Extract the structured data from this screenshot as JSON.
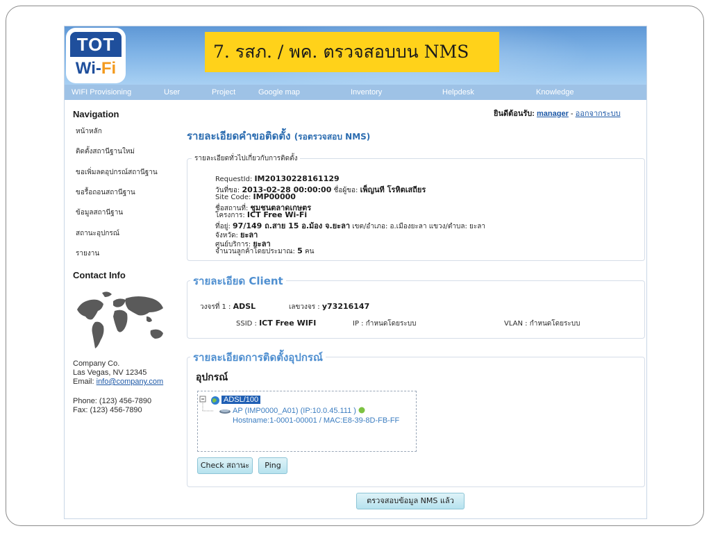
{
  "slide_title": "7. รสภ. / พค. ตรวจสอบบน NMS",
  "logo": {
    "top": "TOT",
    "wi": "Wi-",
    "fi": "Fi"
  },
  "nav": [
    "WIFI Provisioning",
    "User",
    "Project",
    "Google map",
    "Inventory",
    "Helpdesk",
    "Knowledge"
  ],
  "welcome": {
    "prefix": "ยินดีต้อนรับ:",
    "user": "manager",
    "sep": " - ",
    "logout": "ออกจากระบบ"
  },
  "sidebar": {
    "nav_title": "Navigation",
    "items": [
      "หน้าหลัก",
      "ติดตั้งสถานีฐานใหม่",
      "ขอเพิ่มลดอุปกรณ์สถานีฐาน",
      "ขอรื้อถอนสถานีฐาน",
      "ข้อมูลสถานีฐาน",
      "สถานะอุปกรณ์",
      "รายงาน"
    ],
    "contact_title": "Contact Info",
    "company_name": "Company Co.",
    "company_city": "Las Vegas, NV 12345",
    "email_label": "Email: ",
    "email": "info@company.com",
    "phone": "Phone: (123) 456-7890",
    "fax": "Fax: (123) 456-7890"
  },
  "heading": {
    "main": "รายละเอียดคำขอติดตั้ง",
    "sub": "(รอตรวจสอบ  NMS)"
  },
  "general": {
    "legend": "รายละเอียดทั่วไปเกี่ยวกับการติดตั้ง",
    "request_label": "RequestId: ",
    "request_value": "IM20130228161129",
    "date_label": "วันที่ขอ: ",
    "date_value": "2013-02-28 00:00:00",
    "requester_label": "  ชื่อผู้ขอ: ",
    "requester_value": "เพ็ญนที  โรหิตเสถียร",
    "site_code_label": "Site Code: ",
    "site_code_value": "IMP00000",
    "site_name_label": "ชื่อสถานที่: ",
    "site_name_value": "ชุมชนตลาดเกษตร",
    "project_label": "โครงการ: ",
    "project_value": "ICT Free Wi-Fi",
    "address_label": "ที่อยู่: ",
    "address_value": "97/149 ถ.สาย 15 อ.ม้อง จ.ยะลา",
    "address_rest": " เขต/อำเภอ: อ.เมืองยะลา แขวง/ตำบล: ยะลา",
    "province_label": "จังหวัด: ",
    "province_value": "ยะลา",
    "service_center_label": "ศูนย์บริการ: ",
    "service_center_value": "ยะลา",
    "customers_label": "จำนวนลูกค้าโดยประมาณ:  ",
    "customers_value": "5",
    "customers_unit": "  คน"
  },
  "client": {
    "legend": "รายละเอียด Client",
    "circuit_label": "วงจรที่ 1  : ",
    "circuit_value": "ADSL",
    "number_label": "เลขวงจร : ",
    "number_value": "y73216147",
    "ssid_label": "SSID : ",
    "ssid_value": "ICT Free WIFI",
    "ip_label": "IP :  ",
    "ip_value": "กำหนดโดยระบบ",
    "vlan_label": "VLAN :  ",
    "vlan_value": "กำหนดโดยระบบ"
  },
  "device": {
    "legend": "รายละเอียดการติดตั้งอุปกรณ์",
    "sub_title": "อุปกรณ์",
    "tree_root": "ADSL/100",
    "ap_label": "AP (IMP0000_A01) (IP:10.0.45.111 )",
    "hostname": "Hostname:1-0001-00001 / MAC:E8-39-8D-FB-FF",
    "status_color": "#7dc242",
    "check_button": "Check  สถานะ",
    "ping_button": "Ping"
  },
  "verify_button": "ตรวจสอบข้อมูล NMS แล้ว"
}
